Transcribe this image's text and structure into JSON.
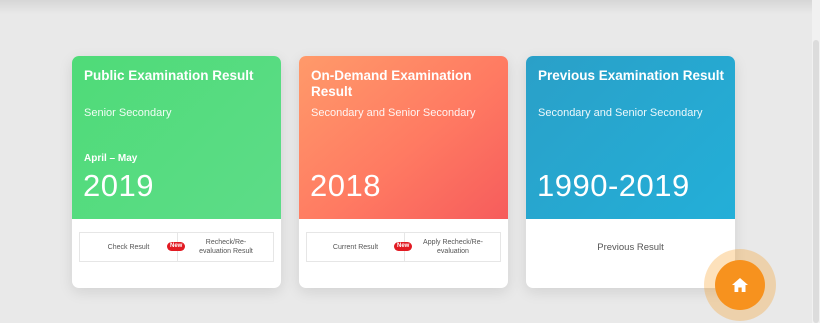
{
  "cards": [
    {
      "title": "Public Examination Result",
      "subtitle": "Senior Secondary",
      "period": "April – May",
      "year": "2019",
      "actions": [
        {
          "label": "Check Result"
        },
        {
          "label": "Recheck/Re-evaluation Result"
        }
      ],
      "badge": "New",
      "color": "#52d97e"
    },
    {
      "title": "On-Demand Examination Result",
      "subtitle": "Secondary and Senior Secondary",
      "year": "2018",
      "actions": [
        {
          "label": "Current Result"
        },
        {
          "label": "Apply Recheck/Re-evaluation"
        }
      ],
      "badge": "New",
      "color": "#fb7a62"
    },
    {
      "title": "Previous Examination Result",
      "subtitle": "Secondary and Senior Secondary",
      "year": "1990-2019",
      "action_label": "Previous Result",
      "color": "#26a8d2"
    }
  ],
  "home_button": {
    "icon": "home-icon",
    "color": "#f7921e"
  }
}
